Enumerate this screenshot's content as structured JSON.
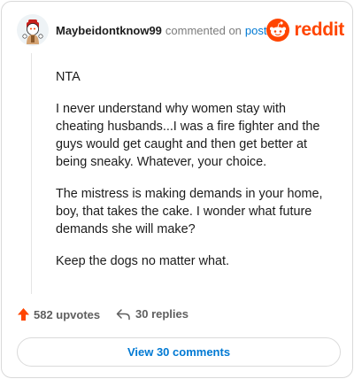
{
  "header": {
    "username": "Maybeidontknow99",
    "commented_text": "commented on",
    "post_link": "post",
    "brand": "reddit",
    "brand_color": "#ff4500",
    "link_color": "#0079d3"
  },
  "comment": {
    "paragraphs": [
      "NTA",
      "I never understand why women stay with cheating husbands...I was a fire fighter and the guys would get caught and then get better at being sneaky. Whatever, your choice.",
      "The mistress is making demands in your home, boy, that takes the cake. I wonder what future demands she will make?",
      "Keep the dogs no matter what."
    ]
  },
  "actions": {
    "upvotes": "582 upvotes",
    "replies": "30 replies",
    "upvote_icon": "upvote-arrow-icon",
    "reply_icon": "reply-arrow-icon"
  },
  "footer": {
    "view_comments": "View 30 comments"
  }
}
